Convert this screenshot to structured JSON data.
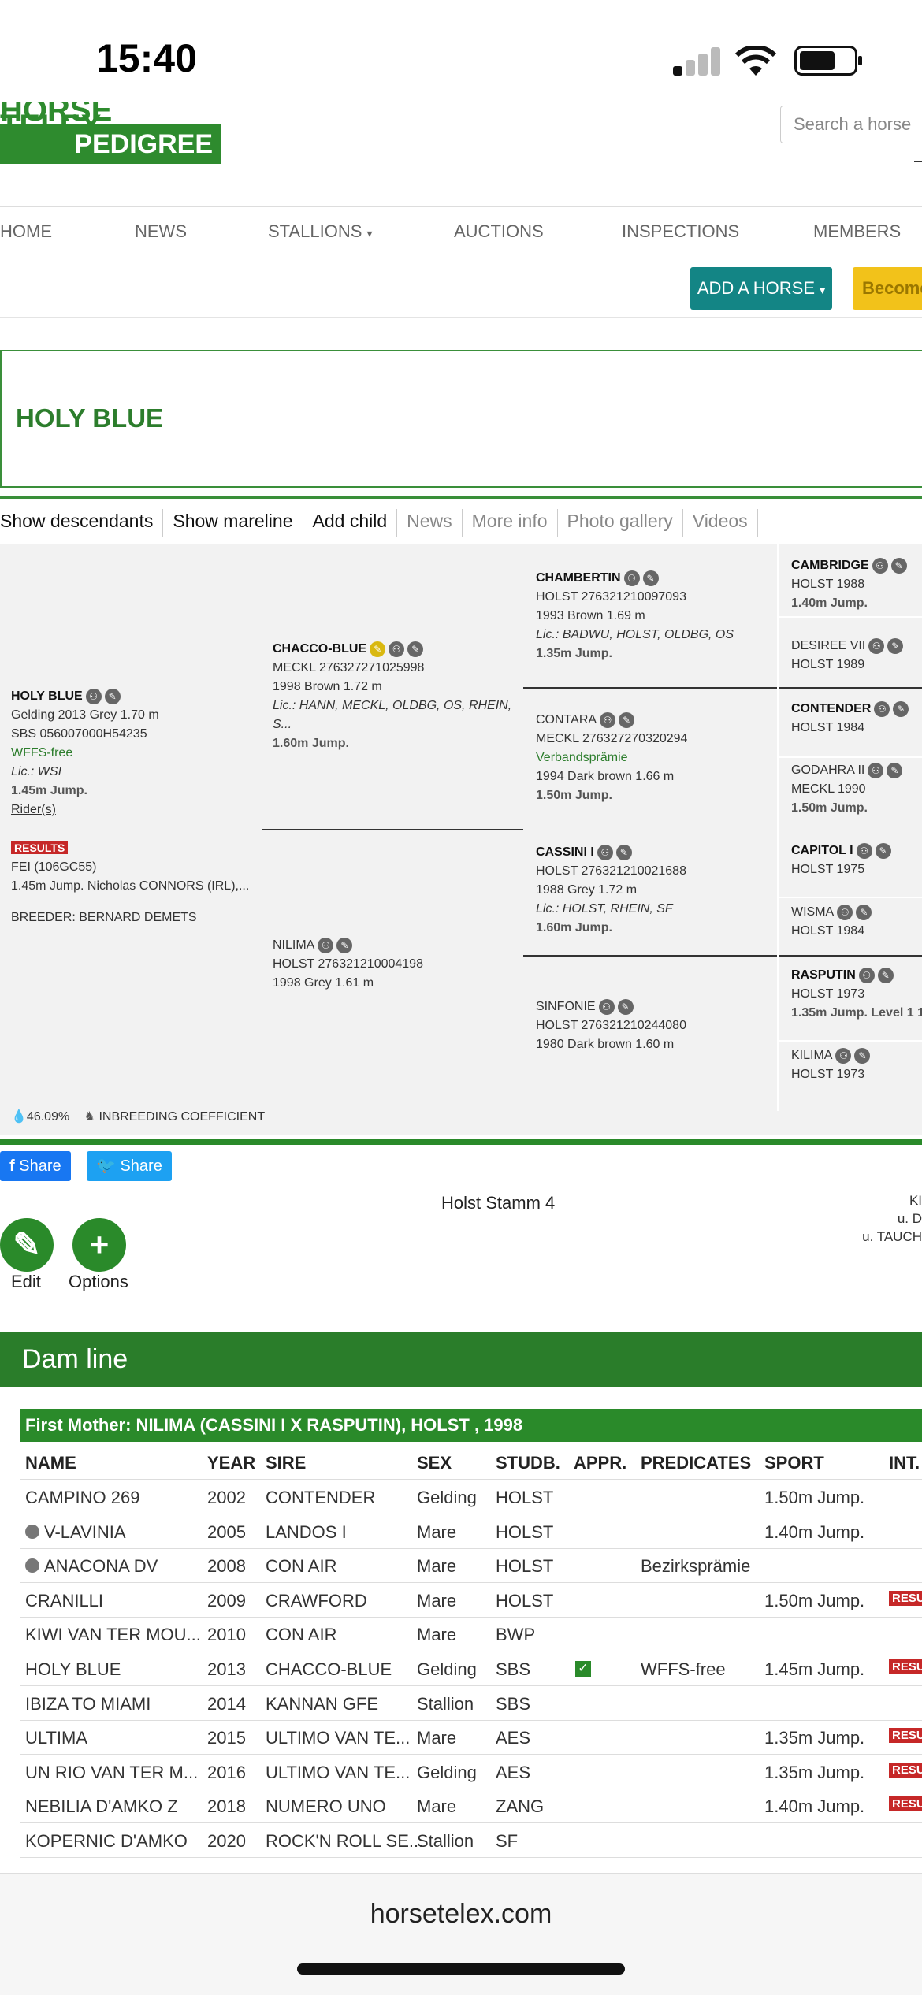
{
  "status": {
    "time": "15:40"
  },
  "logo": {
    "brand": "PEDIGREE",
    "partial": "HORSE TELEX"
  },
  "search": {
    "placeholder": "Search a horse"
  },
  "nav": {
    "items": [
      "HOME",
      "NEWS",
      "STALLIONS",
      "AUCTIONS",
      "INSPECTIONS",
      "MEMBERS"
    ]
  },
  "actions": {
    "add_horse": "ADD A HORSE",
    "become": "Become"
  },
  "horse": {
    "title": "HOLY BLUE"
  },
  "tabs": [
    "Show descendants",
    "Show mareline",
    "Add child",
    "News",
    "More info",
    "Photo gallery",
    "Videos"
  ],
  "pedigree": {
    "subject": {
      "name": "HOLY BLUE",
      "l1": "Gelding 2013 Grey 1.70 m",
      "l2": "SBS 056007000H54235",
      "l3": "WFFS-free",
      "l4": "Lic.: WSI",
      "l5": "1.45m Jump.",
      "l6": "Rider(s)",
      "results_badge": "RESULTS",
      "r1": "FEI (106GC55)",
      "r2": "1.45m Jump. Nicholas CONNORS (IRL),...",
      "breeder": "BREEDER: BERNARD DEMETS"
    },
    "sire": {
      "name": "CHACCO-BLUE",
      "l1": "MECKL 276327271025998",
      "l2": "1998 Brown 1.72 m",
      "l3": "Lic.: HANN, MECKL, OLDBG, OS, RHEIN, S...",
      "l4": "1.60m Jump."
    },
    "dam": {
      "name": "NILIMA",
      "l1": "HOLST 276321210004198",
      "l2": "1998 Grey 1.61 m"
    },
    "ss": {
      "name": "CHAMBERTIN",
      "l1": "HOLST 276321210097093",
      "l2": "1993 Brown 1.69 m",
      "l3": "Lic.: BADWU, HOLST, OLDBG, OS",
      "l4": "1.35m Jump."
    },
    "sd": {
      "name": "CONTARA",
      "l1": "MECKL 276327270320294",
      "l2": "Verbandsprämie",
      "l3": "1994 Dark brown 1.66 m",
      "l4": "1.50m Jump."
    },
    "ds": {
      "name": "CASSINI I",
      "l1": "HOLST 276321210021688",
      "l2": "1988 Grey 1.72 m",
      "l3": "Lic.: HOLST, RHEIN, SF",
      "l4": "1.60m Jump."
    },
    "dd": {
      "name": "SINFONIE",
      "l1": "HOLST 276321210244080",
      "l2": "1980 Dark brown 1.60 m"
    },
    "g4": [
      {
        "name": "CAMBRIDGE",
        "l1": "HOLST 1988",
        "l2": "1.40m Jump."
      },
      {
        "name": "DESIREE VII",
        "l1": "HOLST 1989",
        "l2": ""
      },
      {
        "name": "CONTENDER",
        "l1": "HOLST 1984",
        "l2": ""
      },
      {
        "name": "GODAHRA II",
        "l1": "MECKL 1990",
        "l2": "1.50m Jump."
      },
      {
        "name": "CAPITOL I",
        "l1": "HOLST 1975",
        "l2": ""
      },
      {
        "name": "WISMA",
        "l1": "HOLST 1984",
        "l2": ""
      },
      {
        "name": "RASPUTIN",
        "l1": "HOLST 1973",
        "l2": "1.35m Jump. Level 1 1"
      },
      {
        "name": "KILIMA",
        "l1": "HOLST 1973",
        "l2": ""
      }
    ],
    "inbreeding": {
      "value": "46.09%",
      "label": "INBREEDING COEFFICIENT"
    }
  },
  "share": {
    "facebook": "Share",
    "twitter": "Share"
  },
  "stamm": "Holst Stamm 4",
  "right_partial": {
    "l1": "KI",
    "l2": "u. D",
    "l3": "u. TAUCH"
  },
  "buttons": {
    "edit": "Edit",
    "options": "Options"
  },
  "damline": {
    "title": "Dam line",
    "first_mother": "First Mother: NILIMA (CASSINI I X RASPUTIN), HOLST , 1998",
    "headers": [
      "NAME",
      "YEAR",
      "SIRE",
      "SEX",
      "STUDB.",
      "APPR.",
      "PREDICATES",
      "SPORT",
      "INT."
    ],
    "rows": [
      {
        "name": "CAMPINO 269",
        "year": "2002",
        "sire": "CONTENDER",
        "sex": "Gelding",
        "studb": "HOLST",
        "appr": "",
        "pred": "",
        "sport": "1.50m Jump.",
        "res": ""
      },
      {
        "name": "V-LAVINIA",
        "year": "2005",
        "sire": "LANDOS I",
        "sex": "Mare",
        "studb": "HOLST",
        "appr": "",
        "pred": "",
        "sport": "1.40m Jump.",
        "res": "",
        "icon": true
      },
      {
        "name": "ANACONA DV",
        "year": "2008",
        "sire": "CON AIR",
        "sex": "Mare",
        "studb": "HOLST",
        "appr": "",
        "pred": "Bezirksprämie",
        "sport": "",
        "res": "",
        "icon": true
      },
      {
        "name": "CRANILLI",
        "year": "2009",
        "sire": "CRAWFORD",
        "sex": "Mare",
        "studb": "HOLST",
        "appr": "",
        "pred": "",
        "sport": "1.50m Jump.",
        "res": "RESU"
      },
      {
        "name": "KIWI VAN TER MOU...",
        "year": "2010",
        "sire": "CON AIR",
        "sex": "Mare",
        "studb": "BWP",
        "appr": "",
        "pred": "",
        "sport": "",
        "res": ""
      },
      {
        "name": "HOLY BLUE",
        "year": "2013",
        "sire": "CHACCO-BLUE",
        "sex": "Gelding",
        "studb": "SBS",
        "appr": "✓",
        "pred": "WFFS-free",
        "sport": "1.45m Jump.",
        "res": "RESU"
      },
      {
        "name": "IBIZA TO MIAMI",
        "year": "2014",
        "sire": "KANNAN GFE",
        "sex": "Stallion",
        "studb": "SBS",
        "appr": "",
        "pred": "",
        "sport": "",
        "res": ""
      },
      {
        "name": "ULTIMA",
        "year": "2015",
        "sire": "ULTIMO VAN TE...",
        "sex": "Mare",
        "studb": "AES",
        "appr": "",
        "pred": "",
        "sport": "1.35m Jump.",
        "res": "RESU"
      },
      {
        "name": "UN RIO VAN TER M...",
        "year": "2016",
        "sire": "ULTIMO VAN TE...",
        "sex": "Gelding",
        "studb": "AES",
        "appr": "",
        "pred": "",
        "sport": "1.35m Jump.",
        "res": "RESU"
      },
      {
        "name": "NEBILIA D'AMKO Z",
        "year": "2018",
        "sire": "NUMERO UNO",
        "sex": "Mare",
        "studb": "ZANG",
        "appr": "",
        "pred": "",
        "sport": "1.40m Jump.",
        "res": "RESU"
      },
      {
        "name": "KOPERNIC D'AMKO",
        "year": "2020",
        "sire": "ROCK'N ROLL SE...",
        "sex": "Stallion",
        "studb": "SF",
        "appr": "",
        "pred": "",
        "sport": "",
        "res": ""
      }
    ]
  },
  "browser": {
    "url": "horsetelex.com"
  }
}
